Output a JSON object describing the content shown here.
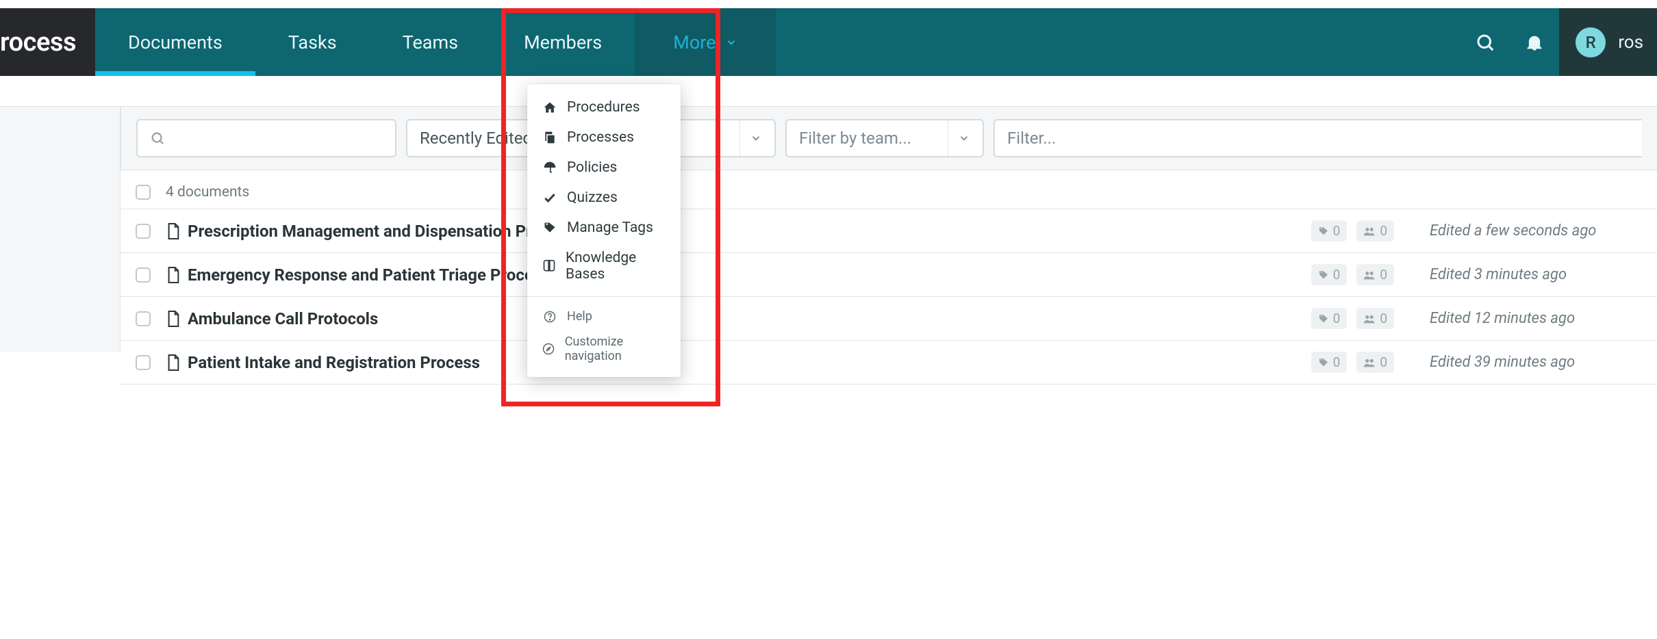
{
  "brand": "rocess",
  "nav": {
    "items": [
      {
        "label": "Documents",
        "active": true
      },
      {
        "label": "Tasks",
        "active": false
      },
      {
        "label": "Teams",
        "active": false
      },
      {
        "label": "Members",
        "active": false
      }
    ],
    "more_label": "More"
  },
  "user": {
    "initial": "R",
    "name": "ros"
  },
  "more_menu": {
    "primary": [
      {
        "label": "Procedures"
      },
      {
        "label": "Processes"
      },
      {
        "label": "Policies"
      },
      {
        "label": "Quizzes"
      },
      {
        "label": "Manage Tags"
      },
      {
        "label": "Knowledge Bases"
      }
    ],
    "secondary": [
      {
        "label": "Help"
      },
      {
        "label": "Customize navigation"
      }
    ]
  },
  "filters": {
    "search_placeholder": "",
    "sort_label": "Recently Edited",
    "team_placeholder": "Filter by team...",
    "last_placeholder": "Filter..."
  },
  "documents": {
    "count_label": "4 documents",
    "rows": [
      {
        "title": "Prescription Management and Dispensation Procedure",
        "tags": 0,
        "people": 0,
        "edited": "Edited a few seconds ago"
      },
      {
        "title": "Emergency Response and Patient Triage Process",
        "tags": 0,
        "people": 0,
        "edited": "Edited 3 minutes ago"
      },
      {
        "title": "Ambulance Call Protocols",
        "tags": 0,
        "people": 0,
        "edited": "Edited 12 minutes ago"
      },
      {
        "title": "Patient Intake and Registration Process",
        "tags": 0,
        "people": 0,
        "edited": "Edited 39 minutes ago"
      }
    ]
  }
}
